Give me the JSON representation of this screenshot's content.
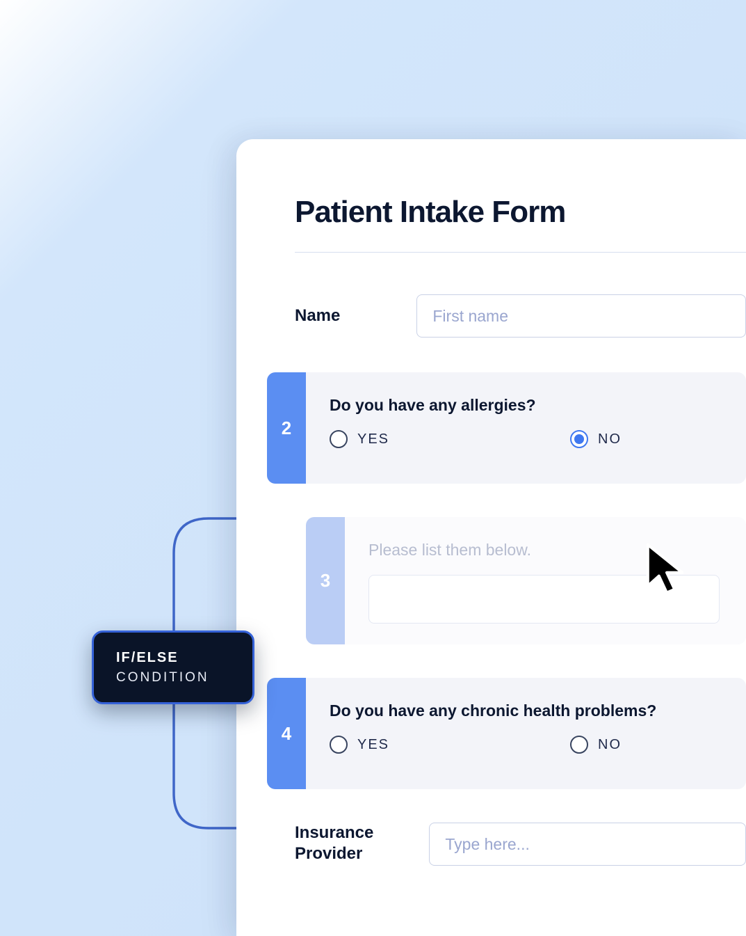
{
  "form": {
    "title": "Patient Intake Form",
    "name_label": "Name",
    "name_placeholder": "First name",
    "insurance_label_line1": "Insurance",
    "insurance_label_line2": "Provider",
    "insurance_placeholder": "Type here..."
  },
  "questions": {
    "q2": {
      "number": "2",
      "text": "Do you have any allergies?",
      "yes": "YES",
      "no": "NO",
      "selected": "no"
    },
    "q3": {
      "number": "3",
      "text": "Please list them below."
    },
    "q4": {
      "number": "4",
      "text": "Do you have any chronic health problems?",
      "yes": "YES",
      "no": "NO"
    }
  },
  "condition": {
    "line1": "IF/ELSE",
    "line2": "CONDITION"
  }
}
